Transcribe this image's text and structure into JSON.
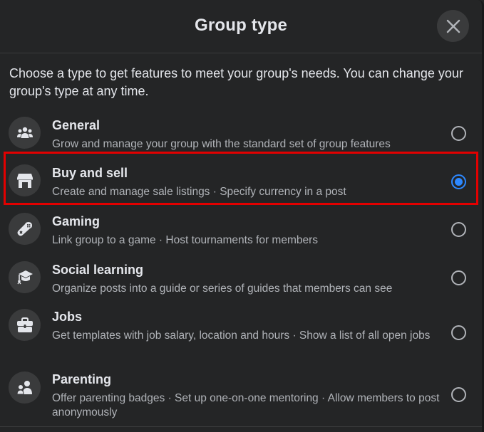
{
  "dialog": {
    "title": "Group type",
    "close_icon": "close-icon",
    "intro": "Choose a type to get features to meet your group's needs. You can change your group's type at any time."
  },
  "options": [
    {
      "label": "General",
      "description": "Grow and manage your group with the standard set of group features",
      "icon": "people-group-icon",
      "selected": false
    },
    {
      "label": "Buy and sell",
      "description": "Create and manage sale listings · Specify currency in a post",
      "icon": "storefront-icon",
      "selected": true
    },
    {
      "label": "Gaming",
      "description": "Link group to a game · Host tournaments for members",
      "icon": "game-controller-icon",
      "selected": false
    },
    {
      "label": "Social learning",
      "description": "Organize posts into a guide or series of guides that members can see",
      "icon": "graduation-cap-icon",
      "selected": false
    },
    {
      "label": "Jobs",
      "description": "Get templates with job salary, location and hours · Show a list of all open jobs",
      "icon": "briefcase-icon",
      "selected": false
    },
    {
      "label": "Parenting",
      "description": "Offer parenting badges · Set up one-on-one mentoring · Allow members to post anonymously",
      "icon": "parent-child-icon",
      "selected": false
    }
  ],
  "colors": {
    "background": "#242526",
    "accent": "#2d88ff",
    "highlight": "#e30000",
    "secondary_text": "#b0b3b8"
  }
}
